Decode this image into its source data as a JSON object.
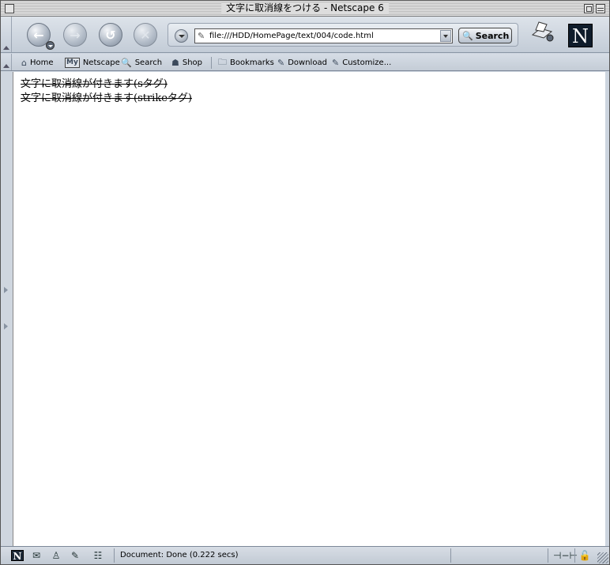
{
  "window": {
    "title": "文字に取消線をつける - Netscape 6"
  },
  "navbar": {
    "url": "file:///HDD/HomePage/text/004/code.html",
    "search_label": "Search",
    "logo_letter": "N"
  },
  "personal_toolbar": {
    "items": [
      {
        "label": "Home",
        "icon": "home-icon"
      },
      {
        "label": "Netscape",
        "icon": "my-netscape-icon"
      },
      {
        "label": "Search",
        "icon": "search-icon"
      },
      {
        "label": "Shop",
        "icon": "shop-icon"
      },
      {
        "label": "Bookmarks",
        "icon": "folder-icon"
      },
      {
        "label": "Download",
        "icon": "bookmark-link-icon"
      },
      {
        "label": "Customize...",
        "icon": "bookmark-link-icon"
      }
    ],
    "my_badge": "My"
  },
  "content": {
    "lines": [
      "文字に取消線が付きます(sタグ)",
      "文字に取消線が付きます(strikeタグ)"
    ]
  },
  "statusbar": {
    "status": "Document: Done (0.222 secs)",
    "component_icons": [
      "netscape-icon",
      "mail-icon",
      "instant-messenger-icon",
      "composer-icon",
      "address-book-icon"
    ],
    "online_icon": "online-plug-icon",
    "security_icon": "unlocked-padlock-icon"
  },
  "colors": {
    "chrome": "#cdd5df",
    "content_bg": "#ffffff",
    "logo_bg": "#0f1c2b"
  }
}
